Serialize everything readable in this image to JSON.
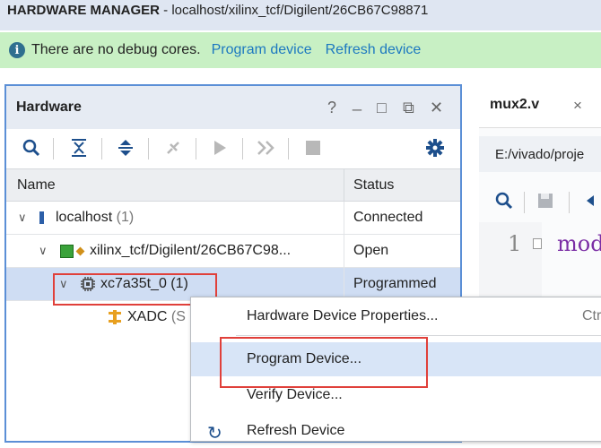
{
  "title_bar": {
    "app_section": "HARDWARE MANAGER",
    "target_path": " - localhost/xilinx_tcf/Digilent/26CB67C98871"
  },
  "info_bar": {
    "icon": "info-icon",
    "message": "There are no debug cores.",
    "links": [
      "Program device",
      "Refresh device"
    ]
  },
  "hardware_panel": {
    "title": "Hardware",
    "window_controls": [
      "?",
      "_",
      "□",
      "⧉",
      "✕"
    ],
    "toolbar_icons": [
      "search-icon",
      "collapse-all-icon",
      "expand-all-icon",
      "auto-connect-icon",
      "run-trigger-icon",
      "run-trigger-immediate-icon",
      "stop-trigger-icon",
      "settings-gear-icon"
    ],
    "columns": [
      "Name",
      "Status"
    ],
    "tree": [
      {
        "name": "localhost",
        "count": "(1)",
        "status": "Connected",
        "icon": "server-icon"
      },
      {
        "name": "xilinx_tcf/Digilent/26CB67C98...",
        "status": "Open",
        "icon": "board-icon"
      },
      {
        "name": "xc7a35t_0",
        "count": "(1)",
        "status": "Programmed",
        "icon": "chip-icon"
      },
      {
        "name": "XADC",
        "count": "(S",
        "icon": "xadc-icon"
      }
    ]
  },
  "editor": {
    "tab_name": "mux2.v",
    "tab_close": "×",
    "path": "E:/vivado/proje",
    "line_number": "1",
    "code_fragment": "mod"
  },
  "context_menu": {
    "items": [
      {
        "label": "Hardware Device Properties...",
        "shortcut": "Ctr"
      },
      {
        "label": "Program Device..."
      },
      {
        "label": "Verify Device..."
      },
      {
        "label": "Refresh Device"
      }
    ]
  },
  "colors": {
    "accent_blue": "#1c78c0",
    "info_bar_green": "#c8f0c4",
    "highlight_red": "#e0403a",
    "selection_blue": "#cfddf3"
  }
}
